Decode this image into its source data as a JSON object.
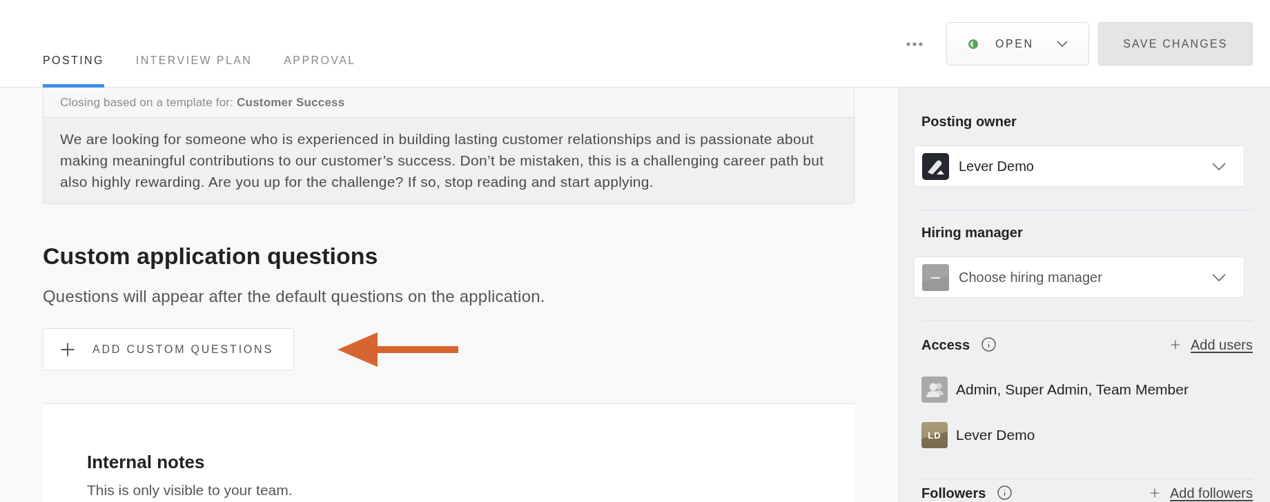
{
  "tabs": [
    {
      "label": "POSTING",
      "selected": true
    },
    {
      "label": "INTERVIEW PLAN",
      "selected": false
    },
    {
      "label": "APPROVAL",
      "selected": false
    }
  ],
  "status_dropdown": {
    "label": "OPEN"
  },
  "save_button": {
    "label": "SAVE CHANGES"
  },
  "template_notice": "Closing based on a template for: **Customer Success**",
  "closing_text": "We are looking for someone who is experienced in building lasting customer relationships and is passionate about making meaningful contributions to our customer’s success. Don’t be mistaken, this is a challenging career path but also highly rewarding. Are you up for the challenge? If so, stop reading and start applying.",
  "custom_questions": {
    "title": "Custom application questions",
    "description": "Questions will appear after the default questions on the application.",
    "add_button": "ADD CUSTOM QUESTIONS"
  },
  "internal_notes": {
    "title": "Internal notes",
    "description": "This is only visible to your team."
  },
  "sidebar": {
    "posting_owner": {
      "label": "Posting owner",
      "value": "Lever Demo"
    },
    "hiring_manager": {
      "label": "Hiring manager",
      "placeholder": "Choose hiring manager"
    },
    "access": {
      "label": "Access",
      "add_link": "Add users",
      "members": [
        {
          "kind": "group",
          "name": "Admin, Super Admin, Team Member"
        },
        {
          "kind": "user",
          "initials": "LD",
          "name": "Lever Demo"
        }
      ]
    },
    "followers": {
      "label": "Followers",
      "add_link": "Add followers"
    }
  }
}
